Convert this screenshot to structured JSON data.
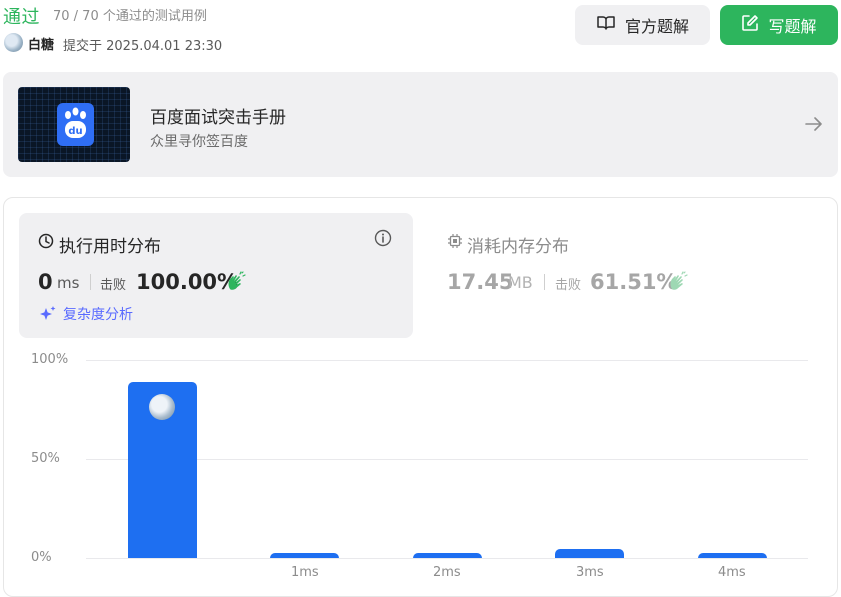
{
  "header": {
    "status": "通过",
    "testcases": "70 / 70 个通过的测试用例",
    "username": "白糖",
    "submitted": "提交于 2025.04.01 23:30",
    "official_solution_label": "官方题解",
    "write_solution_label": "写题解"
  },
  "promo": {
    "title": "百度面试突击手册",
    "subtitle": "众里寻你签百度",
    "logo_text": "du"
  },
  "runtime": {
    "title": "执行用时分布",
    "value": "0",
    "unit": "ms",
    "beats_label": "击败",
    "percent": "100.00%",
    "complexity_label": "复杂度分析"
  },
  "memory": {
    "title": "消耗内存分布",
    "value": "17.45",
    "unit": "MB",
    "beats_label": "击败",
    "percent": "61.51%"
  },
  "colors": {
    "accent_green": "#2db55d",
    "bar_blue": "#1e6ff1",
    "panel_gray": "#f0f0f2"
  },
  "chart_data": {
    "type": "bar",
    "categories": [
      "",
      "1ms",
      "2ms",
      "3ms",
      "4ms"
    ],
    "values": [
      89,
      2.5,
      2.5,
      4.5,
      2.5
    ],
    "y_ticks": [
      "100%",
      "50%",
      "0%"
    ],
    "ylim": [
      0,
      100
    ],
    "grid": true
  }
}
